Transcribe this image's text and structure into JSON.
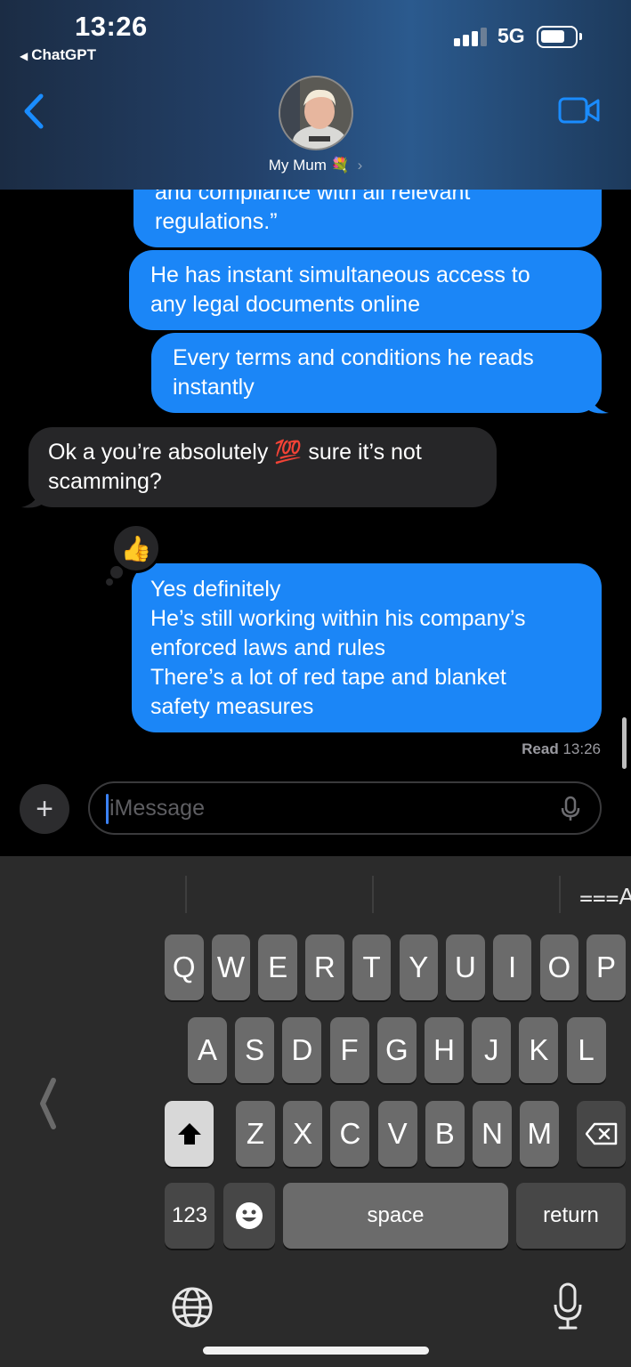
{
  "status_bar": {
    "time": "13:26",
    "back_app": "ChatGPT",
    "network": "5G"
  },
  "header": {
    "contact_name": "My Mum",
    "contact_emoji": "💐",
    "contact_chevron": "›"
  },
  "messages": {
    "m0_line1": "and compliance with all relevant",
    "m0_line2": "regulations.”",
    "m1_line1": "He has instant simultaneous access to",
    "m1_line2": "any legal documents online",
    "m2_line1": "Every terms and conditions he reads",
    "m2_line2": "instantly",
    "m3_pre": "Ok a you’re absolutely ",
    "m3_emoji": "💯",
    "m3_post": " sure it’s not",
    "m3_line2": "scamming?",
    "m4_line1": "Yes definitely",
    "m4_line2": "He’s still working within his company’s",
    "m4_line3": "enforced laws and rules",
    "m4_line4": "There’s a lot of red tape and blanket",
    "m4_line5": "safety measures",
    "tapback": "👍"
  },
  "read_receipt": {
    "label": "Read",
    "time": "13:26"
  },
  "composer": {
    "plus": "+",
    "placeholder": "iMessage"
  },
  "keyboard": {
    "row1": [
      "Q",
      "W",
      "E",
      "R",
      "T",
      "Y",
      "U",
      "I",
      "O",
      "P"
    ],
    "row2": [
      "A",
      "S",
      "D",
      "F",
      "G",
      "H",
      "J",
      "K",
      "L"
    ],
    "row3": [
      "Z",
      "X",
      "C",
      "V",
      "B",
      "N",
      "M"
    ],
    "numbers": "123",
    "space": "space",
    "return": "return",
    "format_icon": "⩶A"
  },
  "colors": {
    "outgoing_bubble": "#1b86f7",
    "incoming_bubble": "#262628",
    "accent": "#1a8cff"
  }
}
